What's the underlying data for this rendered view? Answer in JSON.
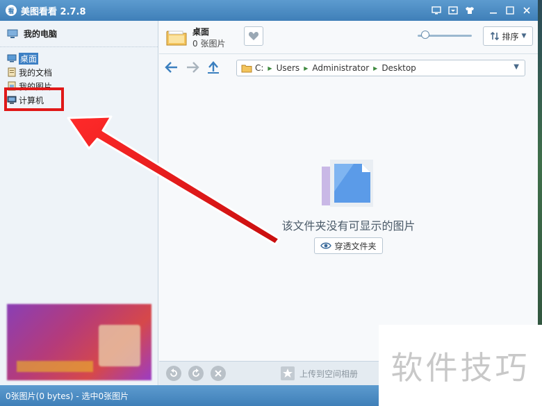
{
  "window": {
    "logo_glyph": "看",
    "title": "美图看看 2.7.8"
  },
  "left_panel": {
    "header": "我的电脑",
    "tree": [
      {
        "label": "桌面",
        "selected": true
      },
      {
        "label": "我的文档",
        "selected": false
      },
      {
        "label": "我的图片",
        "selected": false
      },
      {
        "label": "计算机",
        "selected": false
      }
    ]
  },
  "folder": {
    "name": "桌面",
    "count": "0 张图片"
  },
  "toolbar": {
    "zoom_level": 0.08,
    "sort_label": "排序"
  },
  "path": {
    "crumbs": [
      "C:",
      "Users",
      "Administrator",
      "Desktop"
    ]
  },
  "empty_state": {
    "message": "该文件夹没有可显示的图片",
    "button_label": "穿透文件夹"
  },
  "bottom": {
    "upload_label": "上传到空间相册"
  },
  "status": {
    "text": "0张图片(0 bytes) - 选中0张图片"
  },
  "watermark": {
    "text": "软件技巧"
  },
  "colors": {
    "titlebar": "#4a8cc4",
    "selection": "#3c7fc4",
    "highlight": "#e01818"
  }
}
